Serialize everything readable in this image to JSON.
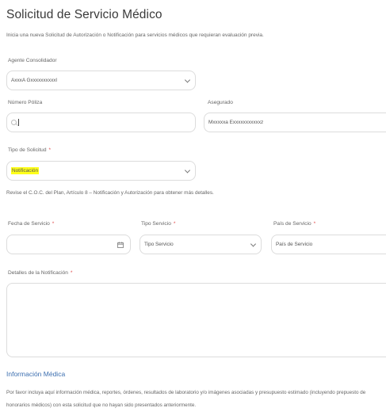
{
  "page": {
    "title": "Solicitud de Servicio Médico",
    "subtitle": "Inicia una nueva Solicitud de Autorización o Notificación para servicios médicos que requieran evaluación previa."
  },
  "form": {
    "agente": {
      "label": "Agente Consolidador",
      "value": "AxxxA Gxxxxxxxxxxl"
    },
    "poliza": {
      "label": "Número Póliza",
      "value": ""
    },
    "asegurado": {
      "label": "Asegurado",
      "value": "Mxxxxxa Exxxxxxxxxxxz"
    },
    "tipo_solicitud": {
      "label": "Tipo de Solicitud",
      "required_mark": "*",
      "value": "Notificación"
    },
    "note": "Revise el C.O.C. del Plan, Artículo 8 – Notificación y Autorización para obtener más detalles.",
    "fecha": {
      "label": "Fecha de Servicio",
      "required_mark": "*",
      "value": ""
    },
    "tipo_servicio": {
      "label": "Tipo Servicio",
      "required_mark": "*",
      "value": "Tipo Servicio"
    },
    "pais": {
      "label": "País de Servicio",
      "required_mark": "*",
      "value": "País de Servicio"
    },
    "detalles": {
      "label": "Detalles de la Notificación",
      "required_mark": "*",
      "value": ""
    }
  },
  "info_medica": {
    "heading": "Información Médica",
    "paragraph": "Por favor incluya aquí información médica, reportes, órdenes, resultados de laboratorio y/o imágenes asociadas y presupuesto estimado (incluyendo prepuesto de honorarios médicos) con esta solicitud que no hayan sido presentados anteriormente."
  },
  "colors": {
    "highlight": "#ffff1a",
    "section_heading": "#3d6fb0",
    "required": "#e04848"
  },
  "icons": [
    "chevron-down-icon",
    "search-icon",
    "calendar-icon"
  ]
}
